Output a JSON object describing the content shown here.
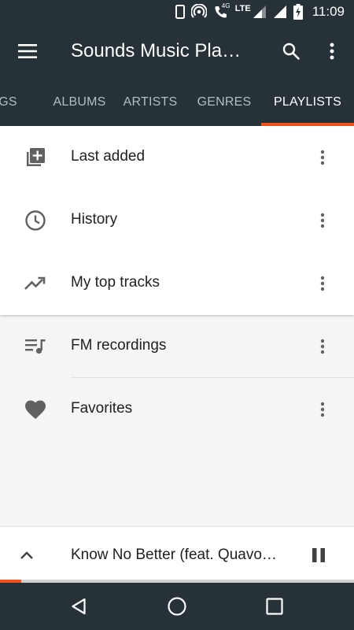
{
  "status_bar": {
    "time": "11:09",
    "network_type": "LTE",
    "network_sub": "4G",
    "icons": [
      "phone-outline-icon",
      "hotspot-icon",
      "wifi-calling-icon",
      "signal-icon",
      "signal-icon",
      "battery-charging-icon"
    ]
  },
  "app_bar": {
    "title": "Sounds Music Pla…",
    "menu_icon": "hamburger-menu-icon",
    "search_icon": "search-icon",
    "more_icon": "more-vert-icon"
  },
  "tabs": {
    "items": [
      {
        "label": "GS",
        "active": false
      },
      {
        "label": "ALBUMS",
        "active": false
      },
      {
        "label": "ARTISTS",
        "active": false
      },
      {
        "label": "GENRES",
        "active": false
      },
      {
        "label": "PLAYLISTS",
        "active": true
      }
    ],
    "indicator_color": "#f4511e"
  },
  "playlists": {
    "items": [
      {
        "label": "Last added",
        "icon": "playlist-add-icon"
      },
      {
        "label": "History",
        "icon": "clock-icon"
      },
      {
        "label": "My top tracks",
        "icon": "trending-up-icon"
      },
      {
        "label": "FM recordings",
        "icon": "queue-music-icon"
      },
      {
        "label": "Favorites",
        "icon": "heart-icon"
      }
    ]
  },
  "now_playing": {
    "track": "Know No Better (feat. Quavo…",
    "expand_icon": "chevron-up-icon",
    "pause_icon": "pause-icon",
    "progress": 0.06
  },
  "nav_bar": {
    "icons": [
      "back-triangle-icon",
      "home-circle-icon",
      "recents-square-icon"
    ]
  },
  "colors": {
    "primary_dark": "#263238",
    "accent": "#f4511e",
    "background": "#f5f5f5"
  }
}
